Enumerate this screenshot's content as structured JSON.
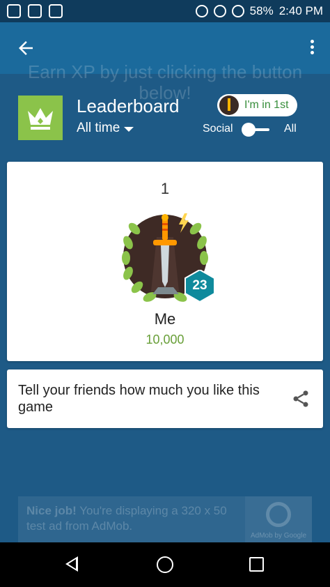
{
  "status_bar": {
    "battery": "58%",
    "time": "2:40 PM"
  },
  "background_text": "Earn XP by just clicking the button below!",
  "header": {
    "title": "Leaderboard",
    "time_filter": "All time",
    "rank_chip": "I'm in 1st",
    "toggle_left": "Social",
    "toggle_right": "All"
  },
  "player_card": {
    "rank": "1",
    "level": "23",
    "name": "Me",
    "score": "10,000"
  },
  "share_card": {
    "text": "Tell your friends how much you like this game"
  },
  "ad": {
    "bold": "Nice job!",
    "text": " You're displaying a 320 x 50 test ad from AdMob.",
    "logo_text": "AdMob by Google"
  },
  "colors": {
    "primary": "#1b6a9c",
    "accent_green": "#8bc34a",
    "score_green": "#689f38",
    "level_teal": "#0f8a9c"
  },
  "icons": [
    "arrow-back-icon",
    "more-vert-icon",
    "crown-icon",
    "share-icon",
    "nav-back-icon",
    "nav-home-icon",
    "nav-recents-icon"
  ]
}
